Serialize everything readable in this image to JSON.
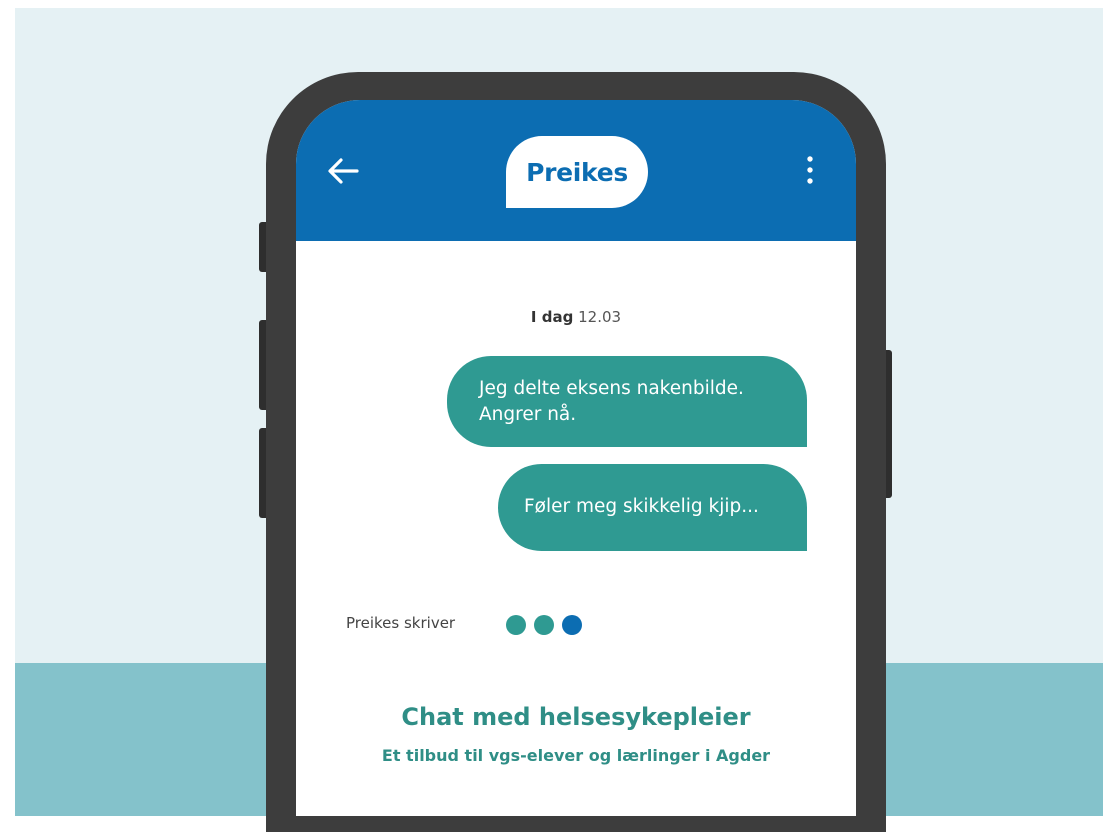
{
  "header": {
    "logo_text": "Preikes",
    "back_icon": "arrow-left-icon",
    "menu_icon": "more-vertical-icon"
  },
  "chat": {
    "date_label": "I dag",
    "date_value": "12.03",
    "messages": [
      {
        "line1": "Jeg delte eksens nakenbilde.",
        "line2": "Angrer nå."
      },
      {
        "line1": "Føler meg skikkelig kjip..."
      }
    ],
    "typing_label": "Preikes skriver"
  },
  "promo": {
    "title": "Chat med helsesykepleier",
    "subtitle": "Et tilbud til vgs-elever og lærlinger i Agder"
  },
  "colors": {
    "header_blue": "#0c6db2",
    "bubble_teal": "#2f9a92",
    "background_light": "#e5f1f4",
    "background_band": "#84c2cb",
    "phone_frame": "#3d3d3d"
  }
}
